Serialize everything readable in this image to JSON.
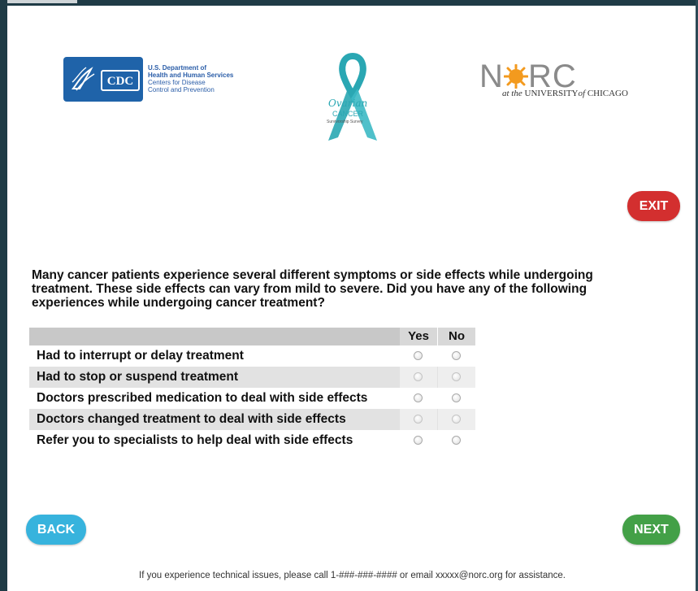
{
  "header": {
    "cdc": {
      "letters": "CDC",
      "line1": "U.S. Department of",
      "line2": "Health and Human Services",
      "line3": "Centers for Disease",
      "line4": "Control and Prevention"
    },
    "ribbon": {
      "word1": "Ovarian",
      "word2": "CANCER",
      "word3": "Survivorship Survey"
    },
    "norc": {
      "n": "N",
      "rc": "RC",
      "sub_prefix": "at the",
      "sub_main": " UNIVERSITY",
      "sub_of": "of",
      "sub_end": " CHICAGO"
    }
  },
  "buttons": {
    "exit": "EXIT",
    "back": "BACK",
    "next": "NEXT"
  },
  "question": "Many cancer patients experience several different symptoms or side effects while undergoing treatment. These side effects can vary from mild to severe. Did you have any of the following experiences while undergoing cancer treatment?",
  "grid": {
    "col_yes": "Yes",
    "col_no": "No",
    "rows": [
      {
        "label": "Had to interrupt or delay treatment"
      },
      {
        "label": "Had to stop or suspend treatment"
      },
      {
        "label": "Doctors prescribed medication to deal with side effects"
      },
      {
        "label": "Doctors changed treatment to deal with side effects"
      },
      {
        "label": "Refer you to specialists to help deal with side effects"
      }
    ]
  },
  "footer": "If you experience technical issues, please call 1-###-###-#### or email xxxxx@norc.org for assistance.",
  "colors": {
    "exit": "#d32f2f",
    "back": "#37b3dd",
    "next": "#43a047",
    "cdc_blue": "#1f63a9",
    "ribbon_teal": "#2aa7b3",
    "norc_orange": "#f39a1e"
  }
}
